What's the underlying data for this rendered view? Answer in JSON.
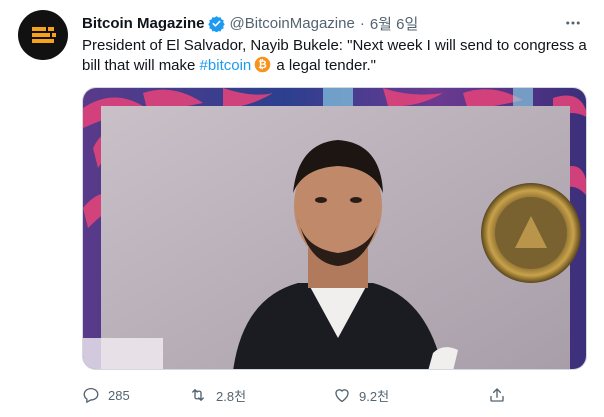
{
  "author": {
    "name": "Bitcoin Magazine",
    "handle": "@BitcoinMagazine",
    "separator": "·",
    "date": "6월 6일"
  },
  "tweet": {
    "text_before": "President of El Salvador, Nayib Bukele: \"Next week I will send to congress a bill that will make ",
    "hashtag": "#bitcoin",
    "text_after": " a legal tender.\""
  },
  "actions": {
    "replies": "285",
    "retweets": "2.8천",
    "likes": "9.2천"
  },
  "icons": {
    "avatar": "bitcoin-magazine-logo",
    "verified": "verified-badge-icon",
    "more": "more-icon",
    "emoji": "bitcoin-emoji-icon",
    "reply": "reply-icon",
    "retweet": "retweet-icon",
    "like": "heart-icon",
    "share": "share-icon"
  },
  "colors": {
    "link": "#1d9bf0",
    "secondary": "#536471",
    "bitcoin": "#f7931a"
  }
}
